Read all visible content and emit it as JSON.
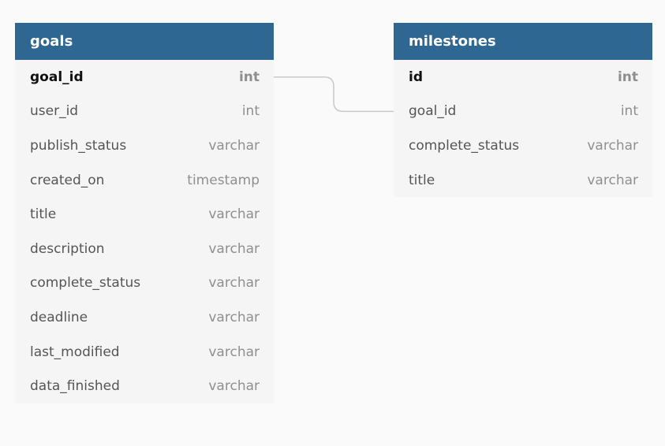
{
  "tables": {
    "goals": {
      "title": "goals",
      "fields": [
        {
          "name": "goal_id",
          "type": "int",
          "pk": true
        },
        {
          "name": "user_id",
          "type": "int"
        },
        {
          "name": "publish_status",
          "type": "varchar"
        },
        {
          "name": "created_on",
          "type": "timestamp"
        },
        {
          "name": "title",
          "type": "varchar"
        },
        {
          "name": "description",
          "type": "varchar"
        },
        {
          "name": "complete_status",
          "type": "varchar"
        },
        {
          "name": "deadline",
          "type": "varchar"
        },
        {
          "name": "last_modified",
          "type": "varchar"
        },
        {
          "name": "data_finished",
          "type": "varchar"
        }
      ]
    },
    "milestones": {
      "title": "milestones",
      "fields": [
        {
          "name": "id",
          "type": "int",
          "pk": true
        },
        {
          "name": "goal_id",
          "type": "int"
        },
        {
          "name": "complete_status",
          "type": "varchar"
        },
        {
          "name": "title",
          "type": "varchar"
        }
      ]
    }
  },
  "relationships": [
    {
      "from_table": "goals",
      "from_field": "goal_id",
      "to_table": "milestones",
      "to_field": "goal_id"
    }
  ],
  "colors": {
    "header": "#2f6793",
    "table_bg": "#f5f5f5",
    "canvas_bg": "#fafafa",
    "connector": "#c8c8c8"
  }
}
